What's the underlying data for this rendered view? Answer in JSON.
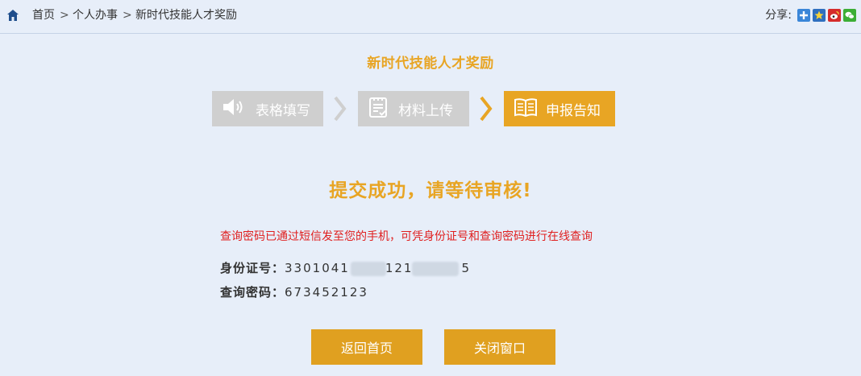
{
  "breadcrumb": {
    "home": "首页",
    "personal": "个人办事",
    "current": "新时代技能人才奖励",
    "separator": ">"
  },
  "share": {
    "label": "分享:",
    "buttons": [
      {
        "name": "share-qzone-icon",
        "color": "#3a86d8"
      },
      {
        "name": "share-qq-icon",
        "color": "#2f6fbf"
      },
      {
        "name": "share-weibo-icon",
        "color": "#d52c2b"
      },
      {
        "name": "share-wechat-icon",
        "color": "#3cae35"
      }
    ]
  },
  "page": {
    "title": "新时代技能人才奖励"
  },
  "steps": [
    {
      "label": "表格填写",
      "icon": "speaker-icon",
      "active": false
    },
    {
      "label": "材料上传",
      "icon": "checklist-icon",
      "active": false
    },
    {
      "label": "申报告知",
      "icon": "book-icon",
      "active": true
    }
  ],
  "result": {
    "success_text": "提交成功，请等待审核!",
    "notice": "查询密码已通过短信发至您的手机，可凭身份证号和查询密码进行在线查询",
    "id_label": "身份证号：",
    "id_value_part1": "3301041",
    "id_value_part2": "121",
    "id_value_part3": "5",
    "pwd_label": "查询密码：",
    "pwd_value": "673452123"
  },
  "buttons": {
    "back": "返回首页",
    "close": "关闭窗口"
  },
  "colors": {
    "accent": "#e8a524",
    "inactive_step": "#cfcfcf",
    "notice": "#e02020",
    "background": "#e7eef9"
  }
}
